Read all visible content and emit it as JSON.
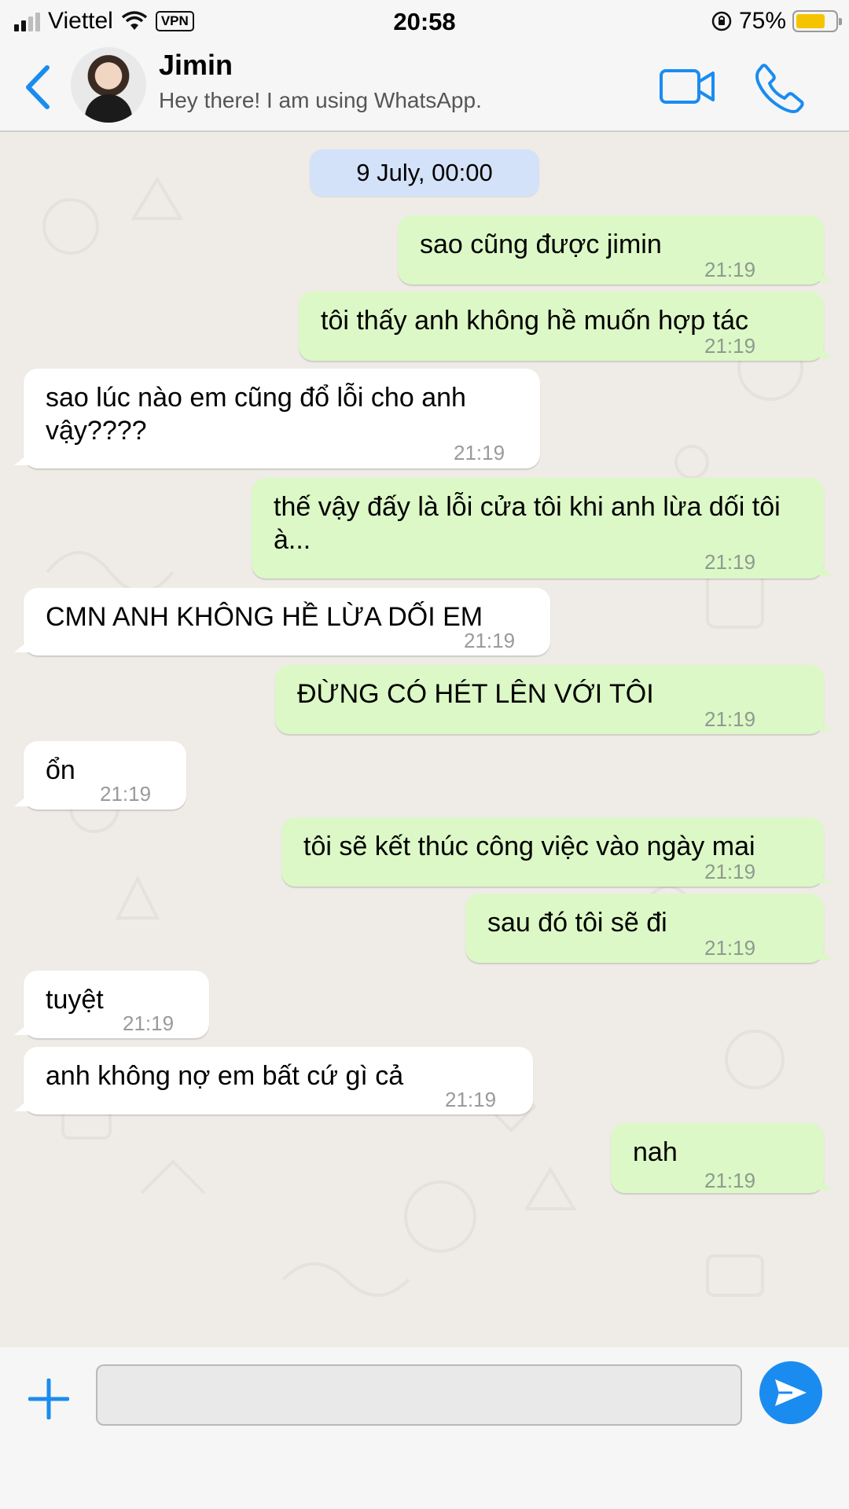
{
  "status_bar": {
    "carrier": "Viettel",
    "vpn": "VPN",
    "time": "20:58",
    "battery_percent": "75%",
    "battery_level": 0.75,
    "signal_bars_active": 2
  },
  "header": {
    "back_icon": "chevron-left-icon",
    "contact_name": "Jimin",
    "contact_status": "Hey there! I am using WhatsApp.",
    "video_icon": "video-camera-icon",
    "call_icon": "phone-icon",
    "accent_color": "#1a8cf0"
  },
  "chat": {
    "date_label": "9 July, 00:00",
    "messages": [
      {
        "direction": "out",
        "text": "sao cũng được jimin",
        "time": "21:19"
      },
      {
        "direction": "out",
        "text": "tôi thấy anh không hề muốn hợp tác",
        "time": "21:19"
      },
      {
        "direction": "in",
        "text": "sao lúc nào em cũng đổ lỗi cho anh vậy????",
        "time": "21:19"
      },
      {
        "direction": "out",
        "text": "thế vậy đấy là lỗi cửa tôi khi anh lừa dối tôi à...",
        "time": "21:19"
      },
      {
        "direction": "in",
        "text": "CMN ANH KHÔNG HỀ LỪA DỐI EM",
        "time": "21:19"
      },
      {
        "direction": "out",
        "text": "ĐỪNG CÓ HÉT LÊN VỚI TÔI",
        "time": "21:19"
      },
      {
        "direction": "in",
        "text": "ổn",
        "time": "21:19"
      },
      {
        "direction": "out",
        "text": "tôi sẽ kết thúc công việc vào ngày mai",
        "time": "21:19"
      },
      {
        "direction": "out",
        "text": "sau đó tôi sẽ đi",
        "time": "21:19"
      },
      {
        "direction": "in",
        "text": "tuyệt",
        "time": "21:19"
      },
      {
        "direction": "in",
        "text": "anh không nợ em bất cứ gì cả",
        "time": "21:19"
      },
      {
        "direction": "out",
        "text": "nah",
        "time": "21:19"
      }
    ],
    "incoming_color": "#ffffff",
    "outgoing_color": "#dcf8c6"
  },
  "input_bar": {
    "plus_icon": "plus-icon",
    "message_value": "",
    "send_icon": "send-icon"
  }
}
